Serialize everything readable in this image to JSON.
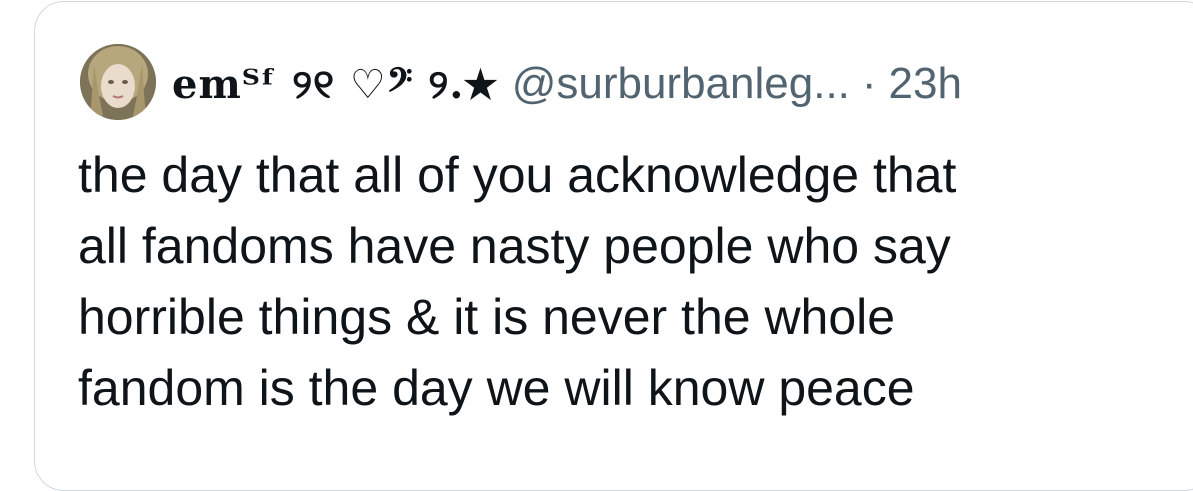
{
  "tweet": {
    "display_name": "emᵀᶠ ୨୧ ♡𝄢 ୨.★",
    "handle": "@surburbanleg...",
    "separator": "·",
    "timestamp": "23h",
    "body_lines": [
      "the day that all of you acknowledge that",
      "all fandoms have nasty people who say",
      "horrible things & it is never the whole",
      "fandom is the day we will know peace"
    ],
    "avatar_icon": "profile-photo"
  },
  "colors": {
    "border": "#cfd9de",
    "text_primary": "#0f1419",
    "text_secondary": "#536471"
  }
}
